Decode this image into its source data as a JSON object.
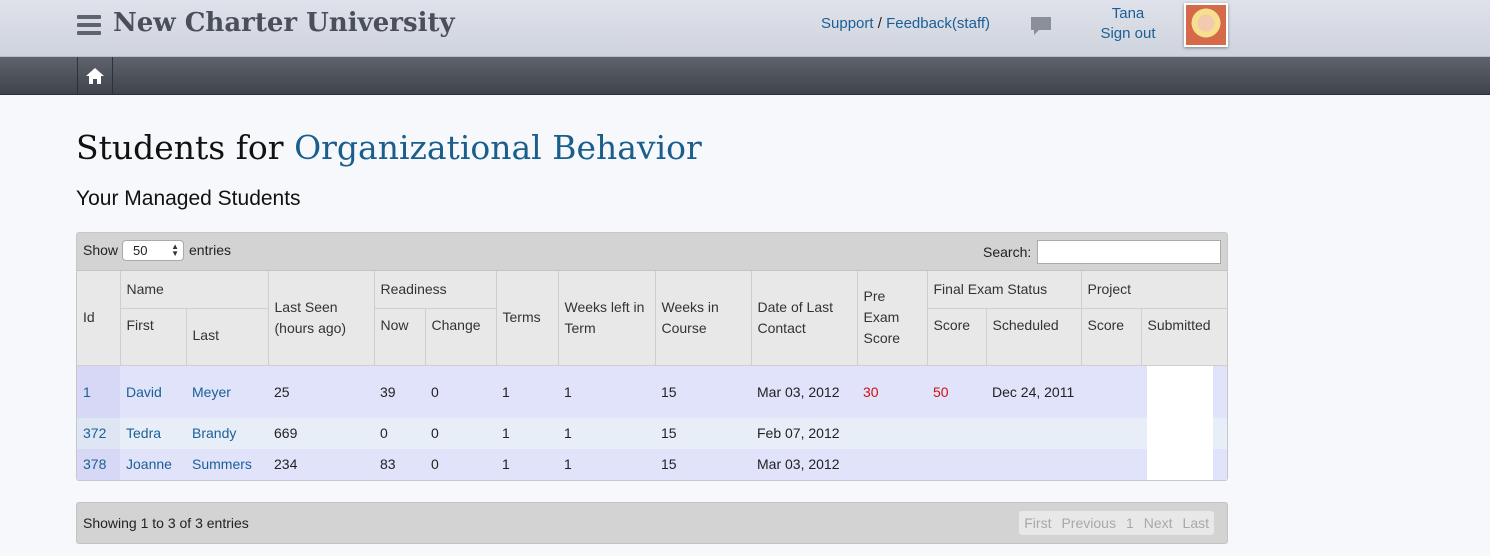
{
  "header": {
    "brand": "New Charter University",
    "support": "Support",
    "separator": "/",
    "feedback": "Feedback(staff)",
    "user_name": "Tana",
    "sign_out": "Sign out"
  },
  "page": {
    "title_prefix": "Students for ",
    "course": "Organizational Behavior",
    "subtitle": "Your Managed Students"
  },
  "controls": {
    "show_label": "Show",
    "page_size": "50",
    "entries_label": "entries",
    "search_label": "Search:",
    "search_value": ""
  },
  "table": {
    "headers": {
      "id": "Id",
      "name": "Name",
      "first": "First",
      "last": "Last",
      "last_seen": "Last Seen (hours ago)",
      "readiness": "Readiness",
      "now": "Now",
      "change": "Change",
      "terms": "Terms",
      "weeks_left": "Weeks left in Term",
      "weeks_in": "Weeks in Course",
      "last_contact": "Date of Last Contact",
      "pre_exam": "Pre Exam Score",
      "final_exam": "Final Exam Status",
      "score": "Score",
      "scheduled": "Scheduled",
      "project": "Project",
      "project_score": "Score",
      "submitted": "Submitted"
    },
    "rows": [
      {
        "id": "1",
        "first": "David",
        "last": "Meyer",
        "seen": "25",
        "now": "39",
        "change": "0",
        "terms": "1",
        "weeks_left": "1",
        "weeks_in": "15",
        "contact": "Mar 03, 2012",
        "pre": "30",
        "final": "50",
        "scheduled": "Dec 24, 2011",
        "proj_score": "",
        "submitted": ""
      },
      {
        "id": "372",
        "first": "Tedra",
        "last": "Brandy",
        "seen": "669",
        "now": "0",
        "change": "0",
        "terms": "1",
        "weeks_left": "1",
        "weeks_in": "15",
        "contact": "Feb 07, 2012",
        "pre": "",
        "final": "",
        "scheduled": "",
        "proj_score": "",
        "submitted": ""
      },
      {
        "id": "378",
        "first": "Joanne",
        "last": "Summers",
        "seen": "234",
        "now": "83",
        "change": "0",
        "terms": "1",
        "weeks_left": "1",
        "weeks_in": "15",
        "contact": "Mar 03, 2012",
        "pre": "",
        "final": "",
        "scheduled": "",
        "proj_score": "",
        "submitted": ""
      }
    ]
  },
  "footer": {
    "info": "Showing 1 to 3 of 3 entries",
    "pager": [
      "First",
      "Previous",
      "1",
      "Next",
      "Last"
    ]
  },
  "colors": {
    "link": "#1a5f96",
    "score_red": "#d01010",
    "nav_bg": "#4a4f58"
  },
  "icons": [
    "menu-icon",
    "chat-icon",
    "home-icon"
  ]
}
